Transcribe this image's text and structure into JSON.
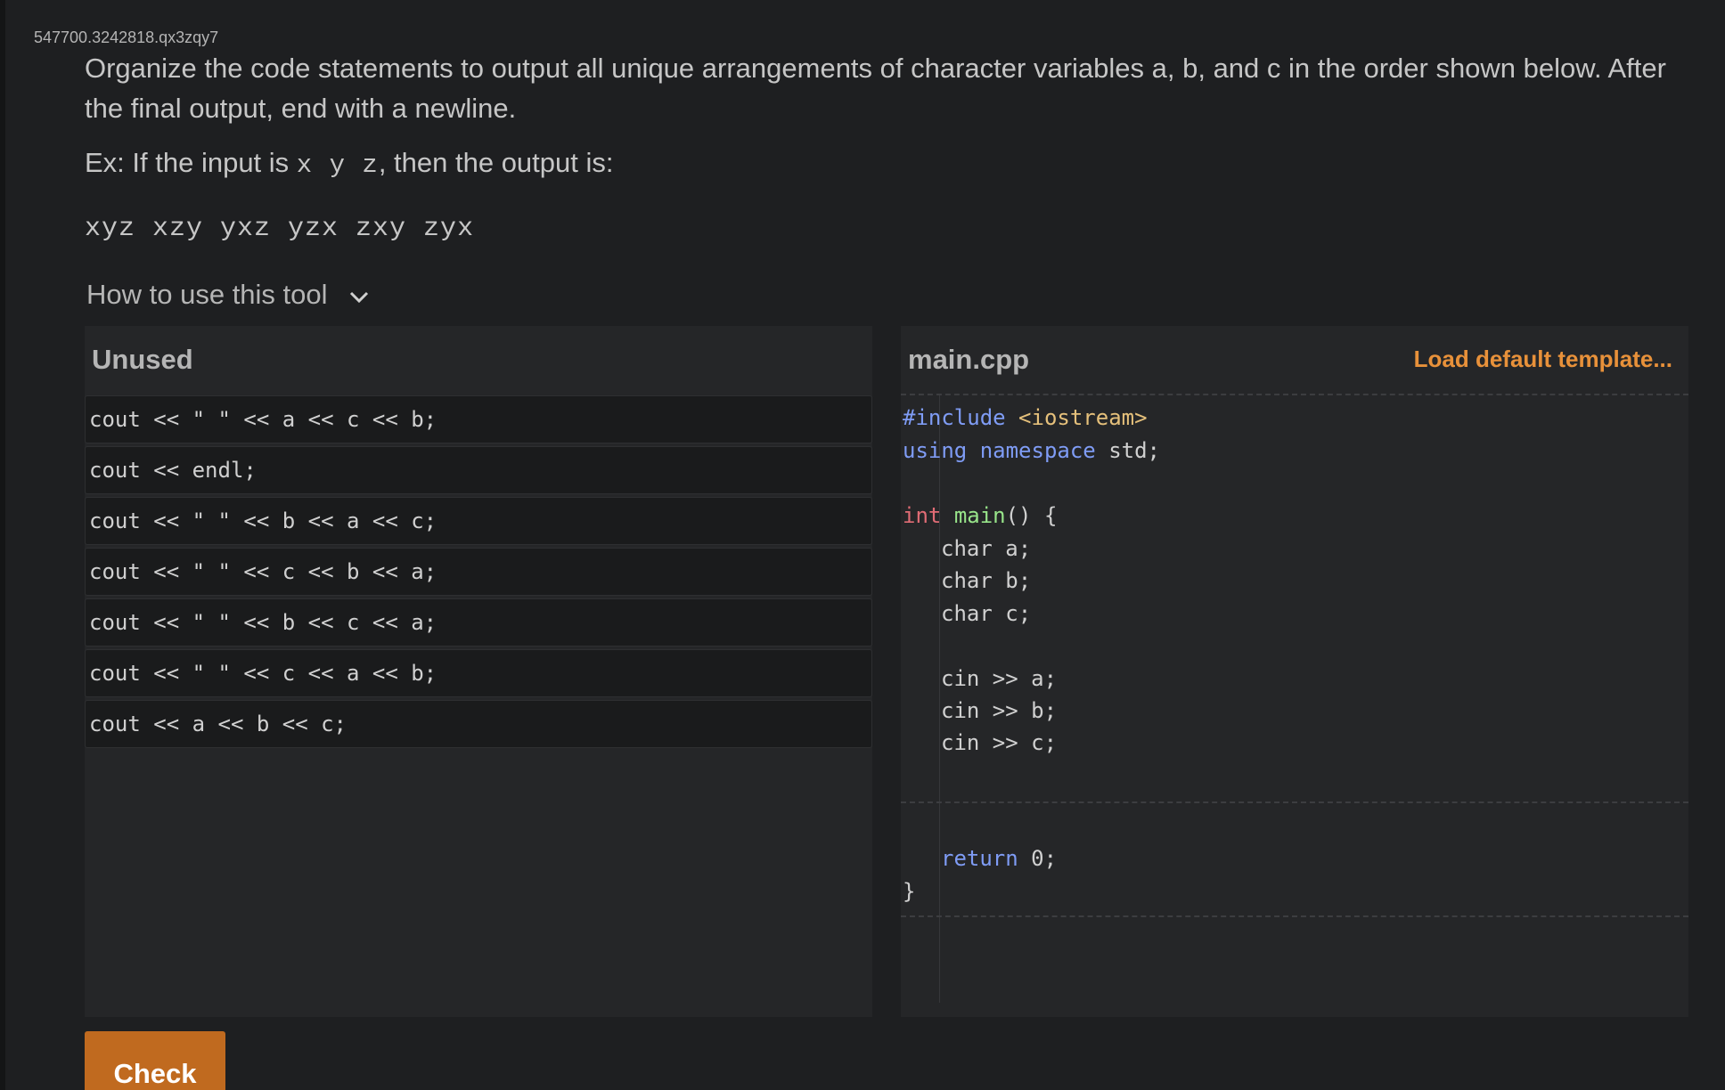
{
  "activity_id": "547700.3242818.qx3zqy7",
  "prompt": "Organize the code statements to output all unique arrangements of character variables a, b, and c in the order shown below. After the final output, end with a newline.",
  "example": {
    "prefix": "Ex: If the input is ",
    "input": "x y z",
    "suffix": ", then the output is:",
    "output": "xyz xzy yxz yzx zxy zyx"
  },
  "howto": {
    "label": "How to use this tool",
    "icon": "chevron-down-icon"
  },
  "unused_panel": {
    "title": "Unused",
    "blocks": [
      "cout << \" \" << a << c << b;",
      "cout << endl;",
      "cout << \" \" << b << a << c;",
      "cout << \" \" << c << b << a;",
      "cout << \" \" << b << c << a;",
      "cout << \" \" << c << a << b;",
      "cout << a << b << c;"
    ]
  },
  "editor_panel": {
    "title": "main.cpp",
    "load_template_label": "Load default template...",
    "code": {
      "include_directive": "#include",
      "include_header": "<iostream>",
      "using_kw": "using",
      "namespace_kw": "namespace",
      "namespace_rest": " std;",
      "int_kw": "int",
      "main_fn": "main",
      "main_rest": "() {",
      "decl_a": "char a;",
      "decl_b": "char b;",
      "decl_c": "char c;",
      "cin_a": "cin >> a;",
      "cin_b": "cin >> b;",
      "cin_c": "cin >> c;",
      "return_kw": "return",
      "return_rest": " 0;",
      "closing_brace": "}"
    }
  },
  "check_button": {
    "label": "Check"
  },
  "colors": {
    "background": "#1e1f21",
    "panel": "#252628",
    "accent_orange": "#e8913a",
    "check_button": "#c06a1f",
    "keyword_blue": "#7f9cf5",
    "keyword_red": "#e06c75",
    "function_green": "#98e58a"
  }
}
